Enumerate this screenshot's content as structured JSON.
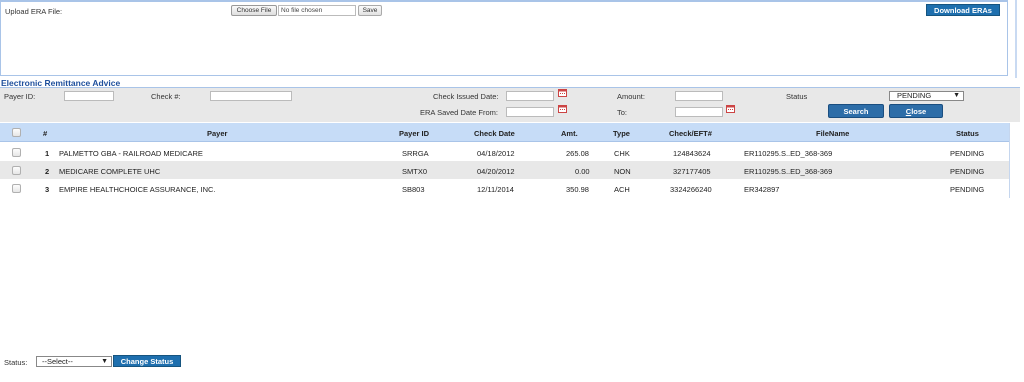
{
  "upload": {
    "label": "Upload ERA File:",
    "choose_file_label": "Choose File",
    "file_name": "No file chosen",
    "save_label": "Save",
    "download_label": "Download ERAs"
  },
  "section_title": "Electronic Remittance Advice",
  "filters": {
    "payer_id_label": "Payer ID:",
    "check_no_label": "Check #:",
    "check_issued_label": "Check Issued Date:",
    "era_saved_label": "ERA Saved Date From:",
    "amount_label": "Amount:",
    "to_label": "To:",
    "status_label": "Status",
    "status_value": "PENDING",
    "search_label": "Search",
    "close_label": "Close",
    "close_accesskey": "C",
    "close_rest": "lose"
  },
  "table": {
    "columns": [
      "#",
      "Payer",
      "Payer ID",
      "Check Date",
      "Amt.",
      "Type",
      "Check/EFT#",
      "FileName",
      "Status"
    ],
    "rows": [
      {
        "num": "1",
        "payer": "PALMETTO GBA - RAILROAD MEDICARE",
        "payer_id": "SRRGA",
        "check_date": "04/18/2012",
        "amt": "265.08",
        "type": "CHK",
        "check_eft": "124843624",
        "filename": "ER110295.S..ED_368-369",
        "status": "PENDING"
      },
      {
        "num": "2",
        "payer": "MEDICARE COMPLETE UHC",
        "payer_id": "SMTX0",
        "check_date": "04/20/2012",
        "amt": "0.00",
        "type": "NON",
        "check_eft": "327177405",
        "filename": "ER110295.S..ED_368-369",
        "status": "PENDING"
      },
      {
        "num": "3",
        "payer": "EMPIRE HEALTHCHOICE ASSURANCE, INC.",
        "payer_id": "SB803",
        "check_date": "12/11/2014",
        "amt": "350.98",
        "type": "ACH",
        "check_eft": "3324266240",
        "filename": "ER342897",
        "status": "PENDING"
      }
    ]
  },
  "bottom": {
    "status_label": "Status:",
    "select_value": "--Select--",
    "change_status_label": "Change Status"
  },
  "colors": {
    "accent": "#1e6fae",
    "header_bg": "#c6dcf7",
    "filter_bg": "#e8e8e8",
    "title_color": "#1e4f9c"
  },
  "icons": {
    "calendar": "calendar-icon",
    "dropdown": "chevron-down-icon"
  }
}
